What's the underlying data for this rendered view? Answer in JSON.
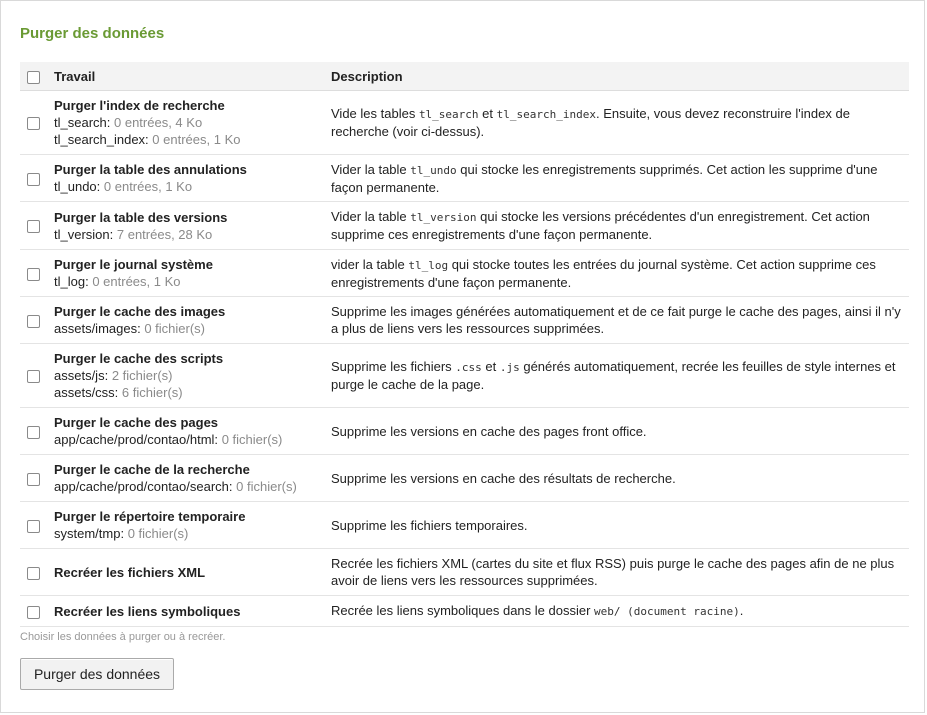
{
  "title": "Purger des données",
  "table": {
    "header_job": "Travail",
    "header_description": "Description"
  },
  "jobs": [
    {
      "title": "Purger l'index de recherche",
      "stats": [
        {
          "label": "tl_search:",
          "value": "0 entrées, 4 Ko"
        },
        {
          "label": "tl_search_index:",
          "value": "0 entrées, 1 Ko"
        }
      ],
      "desc": [
        {
          "t": "Vide les tables "
        },
        {
          "c": "tl_search"
        },
        {
          "t": " et "
        },
        {
          "c": "tl_search_index"
        },
        {
          "t": ". Ensuite, vous devez reconstruire l'index de recherche (voir ci-dessus)."
        }
      ]
    },
    {
      "title": "Purger la table des annulations",
      "stats": [
        {
          "label": "tl_undo:",
          "value": "0 entrées, 1 Ko"
        }
      ],
      "desc": [
        {
          "t": "Vider la table "
        },
        {
          "c": "tl_undo"
        },
        {
          "t": " qui stocke les enregistrements supprimés. Cet action les supprime d'une façon permanente."
        }
      ]
    },
    {
      "title": "Purger la table des versions",
      "stats": [
        {
          "label": "tl_version:",
          "value": "7 entrées, 28 Ko"
        }
      ],
      "desc": [
        {
          "t": "Vider la table "
        },
        {
          "c": "tl_version"
        },
        {
          "t": " qui stocke les versions précédentes d'un enregistrement. Cet action supprime ces enregistrements d'une façon permanente."
        }
      ]
    },
    {
      "title": "Purger le journal système",
      "stats": [
        {
          "label": "tl_log:",
          "value": "0 entrées, 1 Ko"
        }
      ],
      "desc": [
        {
          "t": "vider la table "
        },
        {
          "c": "tl_log"
        },
        {
          "t": " qui stocke toutes les entrées du journal système. Cet action supprime ces enregistrements d'une façon permanente."
        }
      ]
    },
    {
      "title": "Purger le cache des images",
      "stats": [
        {
          "label": "assets/images:",
          "value": "0 fichier(s)"
        }
      ],
      "desc": [
        {
          "t": "Supprime les images générées automatiquement et de ce fait purge le cache des pages, ainsi il n'y a plus de liens vers les ressources supprimées."
        }
      ]
    },
    {
      "title": "Purger le cache des scripts",
      "stats": [
        {
          "label": "assets/js:",
          "value": "2 fichier(s)"
        },
        {
          "label": "assets/css:",
          "value": "6 fichier(s)"
        }
      ],
      "desc": [
        {
          "t": "Supprime les fichiers "
        },
        {
          "c": ".css"
        },
        {
          "t": " et "
        },
        {
          "c": ".js"
        },
        {
          "t": " générés automatiquement, recrée les feuilles de style internes et purge le cache de la page."
        }
      ]
    },
    {
      "title": "Purger le cache des pages",
      "stats": [
        {
          "label": "app/cache/prod/contao/html:",
          "value": "0 fichier(s)"
        }
      ],
      "desc": [
        {
          "t": "Supprime les versions en cache des pages front office."
        }
      ]
    },
    {
      "title": "Purger le cache de la recherche",
      "stats": [
        {
          "label": "app/cache/prod/contao/search:",
          "value": "0 fichier(s)"
        }
      ],
      "desc": [
        {
          "t": "Supprime les versions en cache des résultats de recherche."
        }
      ]
    },
    {
      "title": "Purger le répertoire temporaire",
      "stats": [
        {
          "label": "system/tmp:",
          "value": "0 fichier(s)"
        }
      ],
      "desc": [
        {
          "t": "Supprime les fichiers temporaires."
        }
      ]
    },
    {
      "title": "Recréer les fichiers XML",
      "stats": [],
      "desc": [
        {
          "t": "Recrée les fichiers XML (cartes du site et flux RSS) puis purge le cache des pages afin de ne plus avoir de liens vers les ressources supprimées."
        }
      ]
    },
    {
      "title": "Recréer les liens symboliques",
      "stats": [],
      "desc": [
        {
          "t": "Recrée les liens symboliques dans le dossier "
        },
        {
          "c": "web/ (document racine)"
        },
        {
          "t": "."
        }
      ]
    }
  ],
  "hint": "Choisir les données à purger ou à recréer.",
  "submit_label": "Purger des données"
}
